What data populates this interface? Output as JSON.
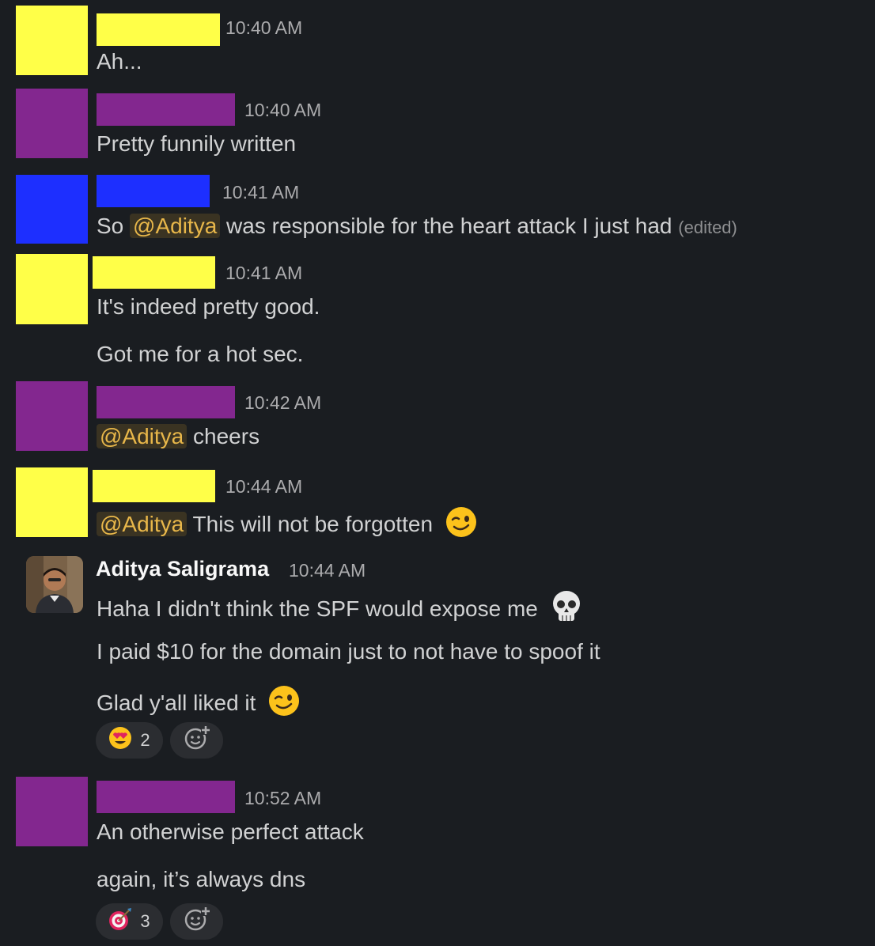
{
  "messages": [
    {
      "id": "m1",
      "time": "10:40 AM",
      "lines": [
        "Ah..."
      ]
    },
    {
      "id": "m2",
      "time": "10:40 AM",
      "lines": [
        "Pretty funnily written"
      ]
    },
    {
      "id": "m3",
      "time": "10:41 AM",
      "before": "So ",
      "mention": "@Aditya",
      "after": " was responsible for the heart attack I just had",
      "edited": "(edited)"
    },
    {
      "id": "m4",
      "time": "10:41 AM",
      "lines": [
        "It's indeed pretty good.",
        "Got me for a hot sec."
      ]
    },
    {
      "id": "m5",
      "time": "10:42 AM",
      "mention": "@Aditya",
      "after": " cheers"
    },
    {
      "id": "m6",
      "time": "10:44 AM",
      "mention": "@Aditya",
      "after": " This will not be forgotten",
      "emoji": "winking-face"
    },
    {
      "id": "m7",
      "name": "Aditya Saligrama",
      "time": "10:44 AM",
      "lines": [
        "Haha I didn't think the SPF would expose me",
        "I paid $10 for the domain just to not have to spoof it",
        "Glad y'all liked it"
      ],
      "line_emojis": [
        "skull",
        "",
        "winking-face"
      ],
      "reaction": {
        "emoji": "heart-eyes",
        "count": "2"
      }
    },
    {
      "id": "m8",
      "time": "10:52 AM",
      "lines": [
        "An otherwise perfect attack",
        "again, it’s always dns"
      ],
      "reaction": {
        "emoji": "direct-hit",
        "count": "3"
      }
    }
  ],
  "colors": {
    "yellow": "#ffff48",
    "purple": "#83278f",
    "blue": "#1d2fff",
    "background": "#1a1d21",
    "mention_text": "#e8b74a"
  }
}
